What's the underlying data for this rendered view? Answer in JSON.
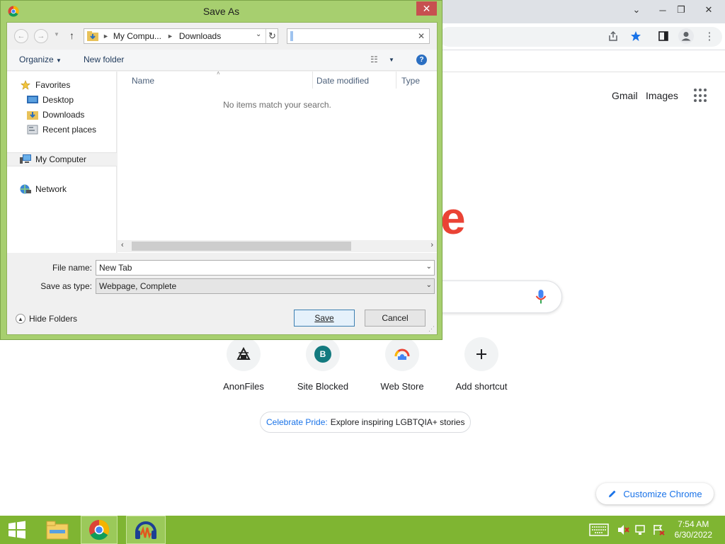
{
  "dialog": {
    "title": "Save As",
    "close_label": "✕",
    "breadcrumb": [
      "My Compu...",
      "Downloads"
    ],
    "toolbar": {
      "organize": "Organize",
      "new_folder": "New folder"
    },
    "nav": {
      "favorites": "Favorites",
      "desktop": "Desktop",
      "downloads": "Downloads",
      "recent_places": "Recent places",
      "my_computer": "My Computer",
      "network": "Network"
    },
    "columns": {
      "name": "Name",
      "date_modified": "Date modified",
      "type": "Type"
    },
    "empty_message": "No items match your search.",
    "search_value": "",
    "file_name_label": "File name:",
    "file_name_value": "New Tab",
    "save_type_label": "Save as type:",
    "save_type_value": "Webpage, Complete",
    "hide_folders": "Hide Folders",
    "save_button": "Save",
    "cancel_button": "Cancel"
  },
  "chrome": {
    "gmail": "Gmail",
    "images": "Images",
    "logo_fragment": "e",
    "shortcuts": [
      {
        "label": "AnonFiles",
        "icon": "anonfiles-icon"
      },
      {
        "label": "Site Blocked",
        "icon": "letter-b-avatar",
        "initial": "B"
      },
      {
        "label": "Web Store",
        "icon": "web-store-icon"
      },
      {
        "label": "Add shortcut",
        "icon": "plus-icon"
      }
    ],
    "pride": {
      "link": "Celebrate Pride:",
      "text": "Explore inspiring LGBTQIA+ stories"
    },
    "customize": "Customize Chrome"
  },
  "taskbar": {
    "time": "7:54 AM",
    "date": "6/30/2022"
  },
  "colors": {
    "taskbar": "#7fb532",
    "dialog_frame": "#a7cf6f",
    "accent_blue": "#1a73e8",
    "close_red": "#c75050"
  }
}
